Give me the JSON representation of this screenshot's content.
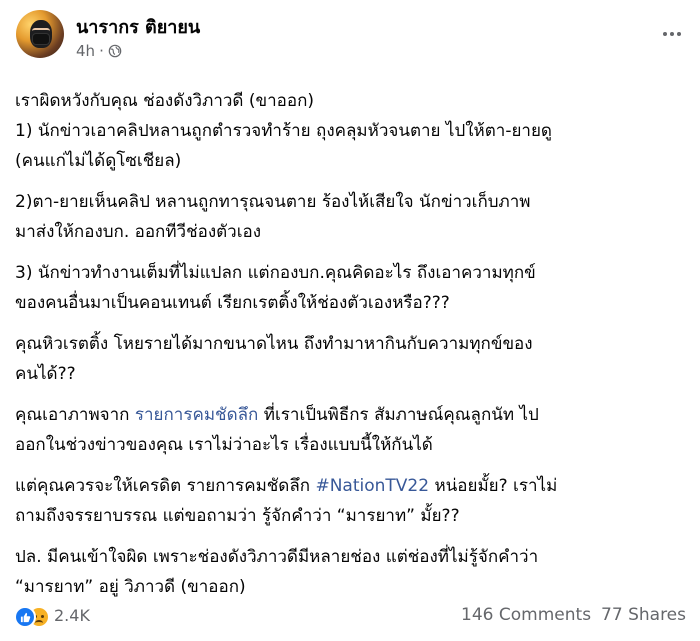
{
  "post": {
    "author": "นารากร ติยายน",
    "time": "4h",
    "privacy_icon": "globe-icon",
    "paragraphs": [
      {
        "lines": [
          [
            {
              "text": "เราผิดหวังกับคุณ ช่องดังวิภาวดี (ขาออก)"
            }
          ],
          [
            {
              "text": "1) นักข่าวเอาคลิปหลานถูกตำรวจทำร้าย ถุงคลุมหัวจนตาย  ไปให้ตา-ยายดู"
            }
          ],
          [
            {
              "text": "(คนแก่ไม่ได้ดูโซเชียล)"
            }
          ]
        ]
      },
      {
        "lines": [
          [
            {
              "text": "2)ตา-ยายเห็นคลิป หลานถูกทารุณจนตาย ร้องไห้เสียใจ  นักข่าวเก็บภาพ"
            }
          ],
          [
            {
              "text": "มาส่งให้กองบก. ออกทีวีช่องตัวเอง"
            }
          ]
        ]
      },
      {
        "lines": [
          [
            {
              "text": "3) นักข่าวทำงานเต็มที่ไม่แปลก  แต่กองบก.คุณคิดอะไร  ถึงเอาความทุกข์"
            }
          ],
          [
            {
              "text": "ของคนอื่นมาเป็นคอนเทนต์  เรียกเรตติ้งให้ช่องตัวเองหรือ???"
            }
          ]
        ]
      },
      {
        "lines": [
          [
            {
              "text": "คุณหิวเรตติ้ง  โหยรายได้มากขนาดไหน  ถึงทำมาหากินกับความทุกข์ของ"
            }
          ],
          [
            {
              "text": "คนได้??"
            }
          ]
        ]
      },
      {
        "lines": [
          [
            {
              "text": "คุณเอาภาพจาก "
            },
            {
              "text": "รายการคมชัดลึก",
              "link": true
            },
            {
              "text": " ที่เราเป็นพิธีกร สัมภาษณ์คุณลูกนัท  ไป"
            }
          ],
          [
            {
              "text": "ออกในช่วงข่าวของคุณ  เราไม่ว่าอะไร  เรื่องแบบนี้ให้กันได้"
            }
          ]
        ]
      },
      {
        "lines": [
          [
            {
              "text": "แต่คุณควรจะให้เครดิต รายการคมชัดลึก "
            },
            {
              "text": "#NationTV22",
              "link": true
            },
            {
              "text": " หน่อยมั้ย?  เราไม่"
            }
          ],
          [
            {
              "text": "ถามถึงจรรยาบรรณ แต่ขอถามว่า รู้จักคำว่า  “มารยาท”  มั้ย??"
            }
          ]
        ]
      },
      {
        "lines": [
          [
            {
              "text": "ปล. มีคนเข้าใจผิด เพราะช่องดังวิภาวดีมีหลายช่อง  แต่ช่องที่ไม่รู้จักคำว่า"
            }
          ],
          [
            {
              "text": "“มารยาท” อยู่ วิภาวดี (ขาออก)"
            }
          ]
        ]
      }
    ],
    "reaction_count": "2.4K",
    "reaction_icons": [
      "like-icon",
      "sad-icon"
    ],
    "comments": "146 Comments",
    "shares": "77 Shares",
    "link_color": "#385898",
    "meta_color": "#65676b"
  }
}
